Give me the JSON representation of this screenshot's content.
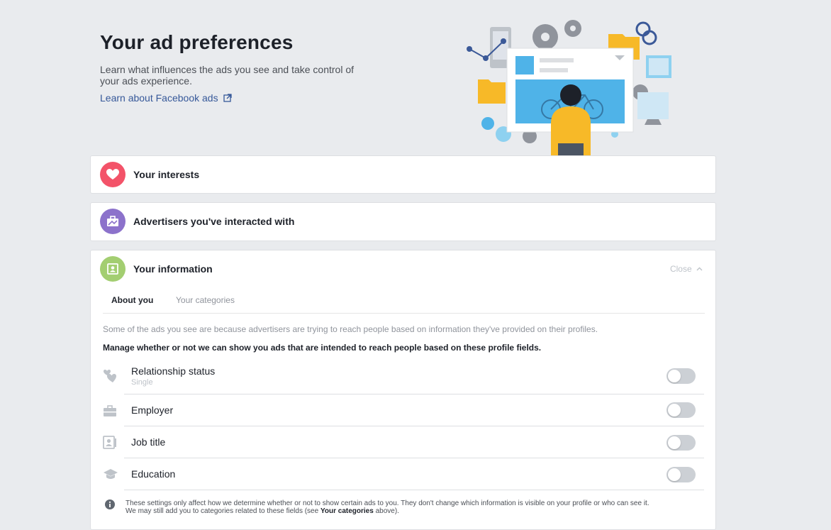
{
  "header": {
    "title": "Your ad preferences",
    "description": "Learn what influences the ads you see and take control of your ads experience.",
    "learn_link": "Learn about Facebook ads"
  },
  "panels": {
    "interests": {
      "title": "Your interests",
      "icon": "heart-icon",
      "color": "#f35369"
    },
    "advertisers": {
      "title": "Advertisers you've interacted with",
      "icon": "briefcase-icon",
      "color": "#8c72cb"
    },
    "information": {
      "title": "Your information",
      "icon": "contact-card-icon",
      "color": "#a3ce71",
      "close_label": "Close",
      "tabs": [
        "About you",
        "Your categories"
      ],
      "active_tab": "About you",
      "description": "Some of the ads you see are because advertisers are trying to reach people based on information they've provided on their profiles.",
      "manage_text": "Manage whether or not we can show you ads that are intended to reach people based on these profile fields.",
      "fields": [
        {
          "label": "Relationship status",
          "value": "Single",
          "icon": "hearts-icon",
          "enabled": false
        },
        {
          "label": "Employer",
          "value": "",
          "icon": "briefcase-icon",
          "enabled": false
        },
        {
          "label": "Job title",
          "value": "",
          "icon": "id-badge-icon",
          "enabled": false
        },
        {
          "label": "Education",
          "value": "",
          "icon": "graduation-cap-icon",
          "enabled": false
        }
      ],
      "note_part1": "These settings only affect how we determine whether or not to show certain ads to you. They don't change which information is visible on your profile or who can see it.",
      "note_part2": "We may still add you to categories related to these fields (see",
      "note_link": "Your categories",
      "note_part3": "above)."
    }
  },
  "colors": {
    "background": "#e9ebee",
    "link": "#365899",
    "toggle_off": "#ccd0d5"
  }
}
